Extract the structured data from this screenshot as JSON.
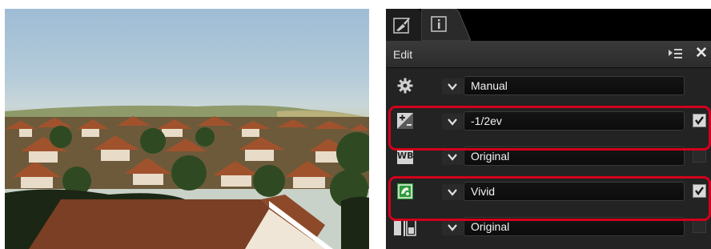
{
  "panel": {
    "tabs": [
      {
        "name": "edit-tab",
        "icon": "edit-brush-icon"
      },
      {
        "name": "info-tab",
        "icon": "info-icon"
      }
    ],
    "header": {
      "title": "Edit",
      "menu_icon": "panel-menu-icon",
      "close_icon": "close-icon",
      "close_glyph": "✕"
    },
    "rows": [
      {
        "icon": "gear-icon",
        "value": "Manual",
        "checkbox": "none",
        "highlighted": false
      },
      {
        "icon": "exposure-compensation-icon",
        "value": "-1/2ev",
        "checkbox": "checked",
        "highlighted": true
      },
      {
        "icon": "white-balance-icon",
        "icon_text": "WB",
        "value": "Original",
        "checkbox": "unchecked",
        "highlighted": false
      },
      {
        "icon": "picture-control-icon",
        "value": "Vivid",
        "checkbox": "checked",
        "highlighted": true
      },
      {
        "icon": "active-d-lighting-icon",
        "value": "Original",
        "checkbox": "unchecked",
        "highlighted": false
      }
    ]
  },
  "colors": {
    "highlight": "#d3001c",
    "panel_bg": "#232323",
    "accent_green": "#2e9a3a"
  }
}
